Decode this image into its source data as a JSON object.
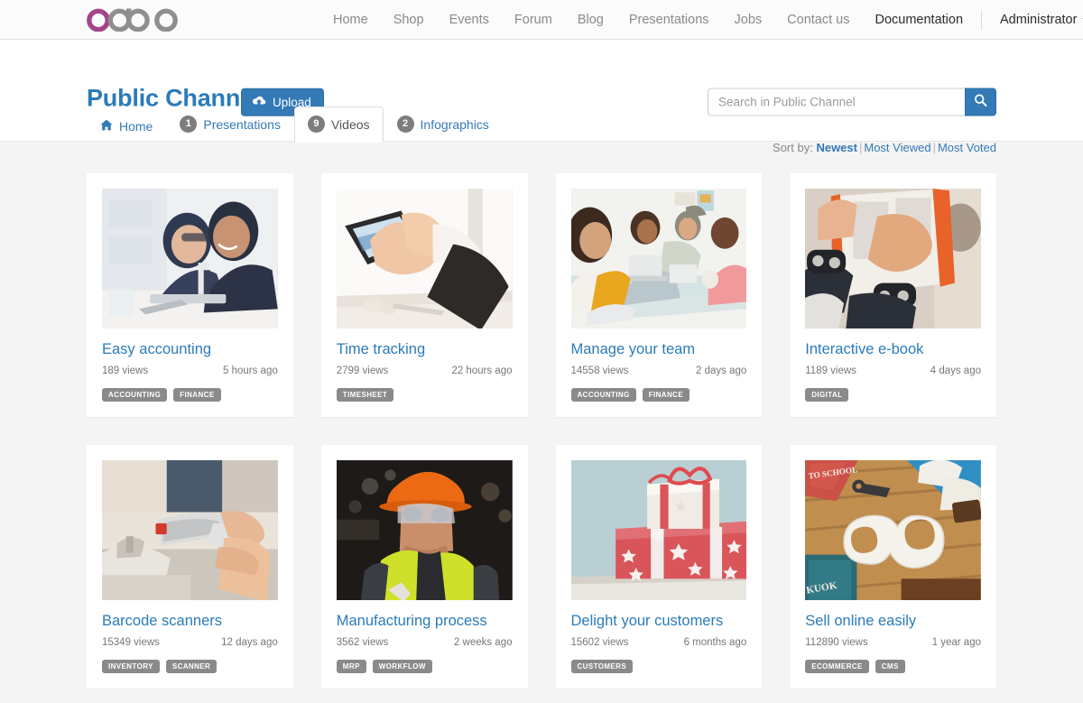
{
  "topnav": {
    "logo_alt": "odoo",
    "links": [
      {
        "label": "Home",
        "active": false
      },
      {
        "label": "Shop",
        "active": false
      },
      {
        "label": "Events",
        "active": false
      },
      {
        "label": "Forum",
        "active": false
      },
      {
        "label": "Blog",
        "active": false
      },
      {
        "label": "Presentations",
        "active": false
      },
      {
        "label": "Jobs",
        "active": false
      },
      {
        "label": "Contact us",
        "active": false
      },
      {
        "label": "Documentation",
        "active": true
      }
    ],
    "user": "Administrator"
  },
  "header": {
    "title": "Public Channel",
    "upload_label": "Upload",
    "upload_icon": "cloud-upload-icon",
    "accent_color": "#337ab7",
    "title_color": "#2b7bb9"
  },
  "search": {
    "placeholder": "Search in Public Channel",
    "value": "",
    "icon": "search-icon"
  },
  "sort": {
    "label": "Sort by:",
    "options": [
      {
        "label": "Newest",
        "active": true
      },
      {
        "label": "Most Viewed",
        "active": false
      },
      {
        "label": "Most Voted",
        "active": false
      }
    ]
  },
  "tabs": [
    {
      "label": "Home",
      "icon": "home-icon",
      "badge": null,
      "active": false
    },
    {
      "label": "Presentations",
      "icon": null,
      "badge": "1",
      "active": false
    },
    {
      "label": "Videos",
      "icon": null,
      "badge": "9",
      "active": true
    },
    {
      "label": "Infographics",
      "icon": null,
      "badge": "2",
      "active": false
    }
  ],
  "cards": [
    {
      "title": "Easy accounting",
      "views": "189 views",
      "time": "5 hours ago",
      "tags": [
        "Accounting",
        "Finance"
      ],
      "thumb": "two-businessmen-reviewing-tablet"
    },
    {
      "title": "Time tracking",
      "views": "2799 views",
      "time": "22 hours ago",
      "tags": [
        "Timesheet"
      ],
      "thumb": "hand-holding-smartphone"
    },
    {
      "title": "Manage your team",
      "views": "14558 views",
      "time": "2 days ago",
      "tags": [
        "Accounting",
        "Finance"
      ],
      "thumb": "team-meeting-with-tablet"
    },
    {
      "title": "Interactive e-book",
      "views": "1189 views",
      "time": "4 days ago",
      "tags": [
        "Digital"
      ],
      "thumb": "hands-holding-open-book"
    },
    {
      "title": "Barcode scanners",
      "views": "15349 views",
      "time": "12 days ago",
      "tags": [
        "Inventory",
        "Scanner"
      ],
      "thumb": "hand-holding-barcode-scanner"
    },
    {
      "title": "Manufacturing process",
      "views": "3562 views",
      "time": "2 weeks ago",
      "tags": [
        "MRP",
        "Workflow"
      ],
      "thumb": "worker-in-hardhat-and-hivis-vest"
    },
    {
      "title": "Delight your customers",
      "views": "15602 views",
      "time": "6 months ago",
      "tags": [
        "Customers"
      ],
      "thumb": "stacked-gift-boxes"
    },
    {
      "title": "Sell online easily",
      "views": "112890 views",
      "time": "1 year ago",
      "tags": [
        "Ecommerce",
        "CMS"
      ],
      "thumb": "white-ampersand-on-wooden-desk"
    }
  ]
}
